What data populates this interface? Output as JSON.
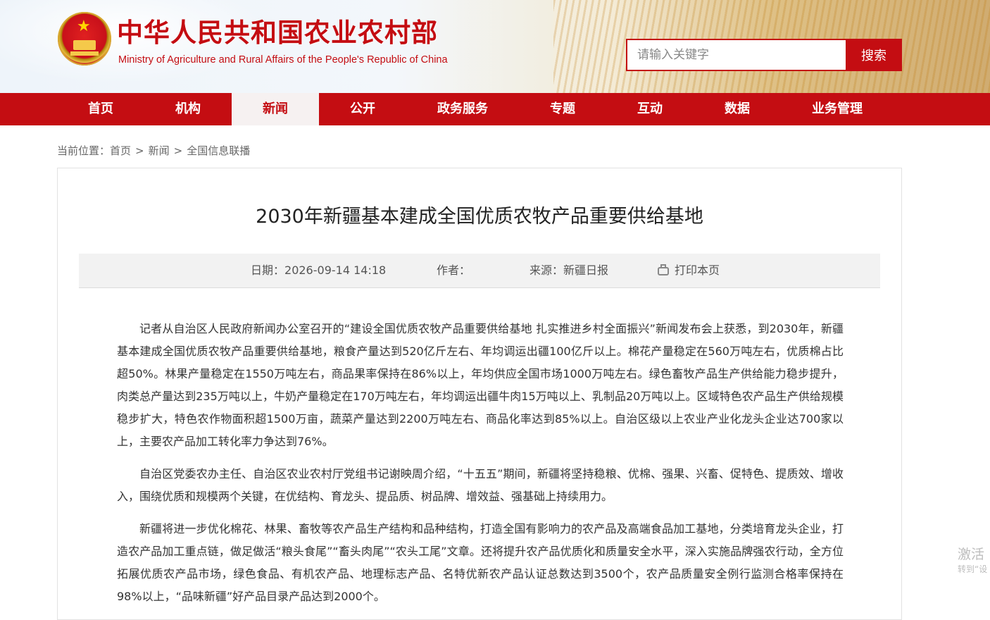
{
  "header": {
    "site_title": "中华人民共和国农业农村部",
    "site_subtitle": "Ministry of Agriculture and Rural Affairs of the People's Republic of China",
    "search": {
      "placeholder": "请输入关键字",
      "button_label": "搜索"
    }
  },
  "nav": {
    "items": [
      {
        "label": "首页"
      },
      {
        "label": "机构"
      },
      {
        "label": "新闻",
        "active": true
      },
      {
        "label": "公开"
      },
      {
        "label": "政务服务"
      },
      {
        "label": "专题"
      },
      {
        "label": "互动"
      },
      {
        "label": "数据"
      },
      {
        "label": "业务管理"
      }
    ]
  },
  "breadcrumb": {
    "prefix": "当前位置：",
    "items": [
      "首页",
      "新闻",
      "全国信息联播"
    ],
    "separator": ">"
  },
  "article": {
    "title": "2030年新疆基本建成全国优质农牧产品重要供给基地",
    "meta": {
      "date_label": "日期：",
      "date": "2026-09-14 14:18",
      "author_label": "作者：",
      "author": "",
      "source_label": "来源：",
      "source": "新疆日报",
      "print_label": "打印本页"
    },
    "paragraphs": [
      "记者从自治区人民政府新闻办公室召开的“建设全国优质农牧产品重要供给基地 扎实推进乡村全面振兴”新闻发布会上获悉，到2030年，新疆基本建成全国优质农牧产品重要供给基地，粮食产量达到520亿斤左右、年均调运出疆100亿斤以上。棉花产量稳定在560万吨左右，优质棉占比超50%。林果产量稳定在1550万吨左右，商品果率保持在86%以上，年均供应全国市场1000万吨左右。绿色畜牧产品生产供给能力稳步提升，肉类总产量达到235万吨以上，牛奶产量稳定在170万吨左右，年均调运出疆牛肉15万吨以上、乳制品20万吨以上。区域特色农产品生产供给规模稳步扩大，特色农作物面积超1500万亩，蔬菜产量达到2200万吨左右、商品化率达到85%以上。自治区级以上农业产业化龙头企业达700家以上，主要农产品加工转化率力争达到76%。",
      "自治区党委农办主任、自治区农业农村厅党组书记谢映周介绍，“十五五”期间，新疆将坚持稳粮、优棉、强果、兴畜、促特色、提质效、增收入，围绕优质和规模两个关键，在优结构、育龙头、提品质、树品牌、增效益、强基础上持续用力。",
      "新疆将进一步优化棉花、林果、畜牧等农产品生产结构和品种结构，打造全国有影响力的农产品及高端食品加工基地，分类培育龙头企业，打造农产品加工重点链，做足做活“粮头食尾”“畜头肉尾”“农头工尾”文章。还将提升农产品优质化和质量安全水平，深入实施品牌强农行动，全方位拓展优质农产品市场，绿色食品、有机农产品、地理标志产品、名特优新农产品认证总数达到3500个，农产品质量安全例行监测合格率保持在98%以上，“品味新疆”好产品目录产品达到2000个。"
    ]
  },
  "overlay": {
    "activate_text": "激活",
    "activate_sub": "转到“设"
  },
  "colors": {
    "brand_red": "#c40d12",
    "meta_bg": "#f2f2f2"
  },
  "icons": {
    "print": "printer-icon",
    "emblem": "national-emblem-icon"
  }
}
